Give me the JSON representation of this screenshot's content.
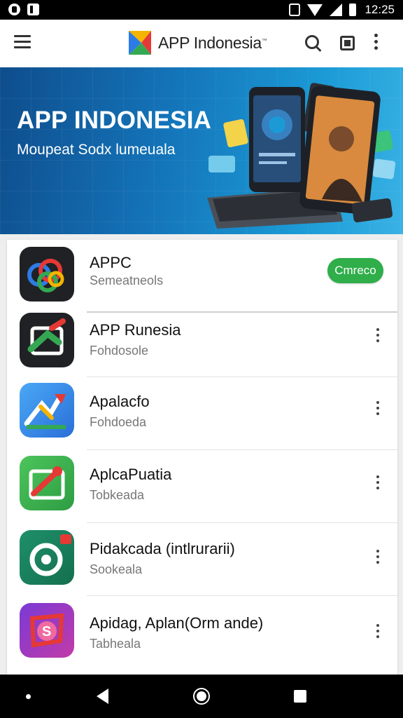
{
  "status_bar": {
    "time": "12:25"
  },
  "app_bar": {
    "title": "APP Indonesia",
    "trademark": "™"
  },
  "banner": {
    "title": "APP INDONESIA",
    "subtitle": "Moupeat Sodx lumeuala"
  },
  "apps": [
    {
      "name": "APPC",
      "subtitle": "Semeatneols",
      "action_label": "Cmreco"
    },
    {
      "name": "APP Runesia",
      "subtitle": "Fohdosole"
    },
    {
      "name": "Apalacfo",
      "subtitle": "Fohdoeda"
    },
    {
      "name": "AplcaPuatia",
      "subtitle": "Tobkeada"
    },
    {
      "name": "Pidakcada (intlrurarii)",
      "subtitle": "Sookeala"
    },
    {
      "name": "Apidag, Aplan(Orm ande)",
      "subtitle": "Tabheala"
    }
  ],
  "colors": {
    "accent_green": "#2fae4a",
    "banner_blue": "#1473b8"
  },
  "icons": [
    "menu-icon",
    "search-icon",
    "cast-icon",
    "more-vert-icon",
    "back-icon",
    "home-icon",
    "recents-icon"
  ]
}
